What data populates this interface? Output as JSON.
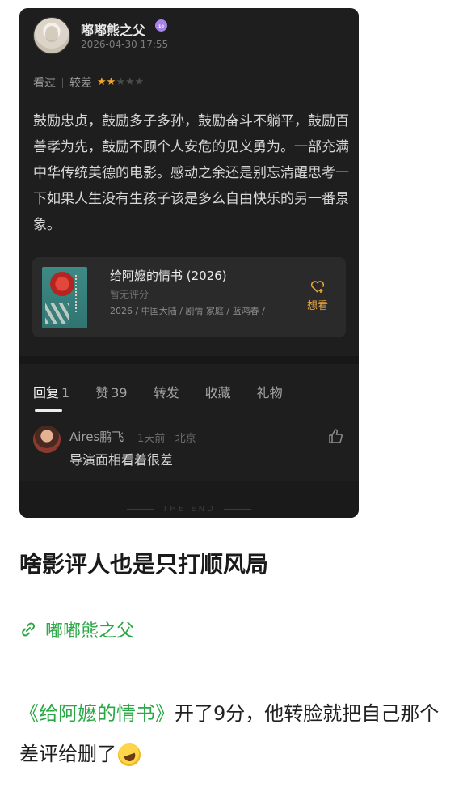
{
  "post": {
    "user": {
      "name": "嘟嘟熊之父",
      "badge": "₁₀",
      "time": "2026-04-30 17:55"
    },
    "rating": {
      "seen": "看过",
      "verdict": "较差",
      "stars": 2,
      "max_stars": 5
    },
    "review_text": "鼓励忠贞，鼓励多子多孙，鼓励奋斗不躺平，鼓励百善孝为先，鼓励不顾个人安危的见义勇为。一部充满中华传统美德的电影。感动之余还是别忘清醒思考一下如果人生没有生孩子该是多么自由快乐的另一番景象。",
    "movie": {
      "title": "给阿嬷的情书 (2026)",
      "score": "暂无评分",
      "meta": "2026 / 中国大陆 / 剧情 家庭 / 蓝鸿春 /",
      "want_label": "想看"
    },
    "tabs": [
      {
        "label": "回复",
        "count": "1"
      },
      {
        "label": "赞",
        "count": "39"
      },
      {
        "label": "转发",
        "count": ""
      },
      {
        "label": "收藏",
        "count": ""
      },
      {
        "label": "礼物",
        "count": ""
      }
    ],
    "comment": {
      "name": "Aires鹏飞",
      "meta": "1天前 · 北京",
      "text": "导演面相看着很差"
    },
    "end_text": "THE END"
  },
  "article": {
    "headline": "啥影评人也是只打顺风局",
    "author_link": "嘟嘟熊之父",
    "paragraph": {
      "movie_link": "《给阿嬷的情书》",
      "text": "开了9分，他转脸就把自己那个差评给删了"
    }
  },
  "colors": {
    "accent_green": "#2aa845",
    "star_orange": "#f0a62c",
    "card_bg": "#1e1e1f"
  }
}
